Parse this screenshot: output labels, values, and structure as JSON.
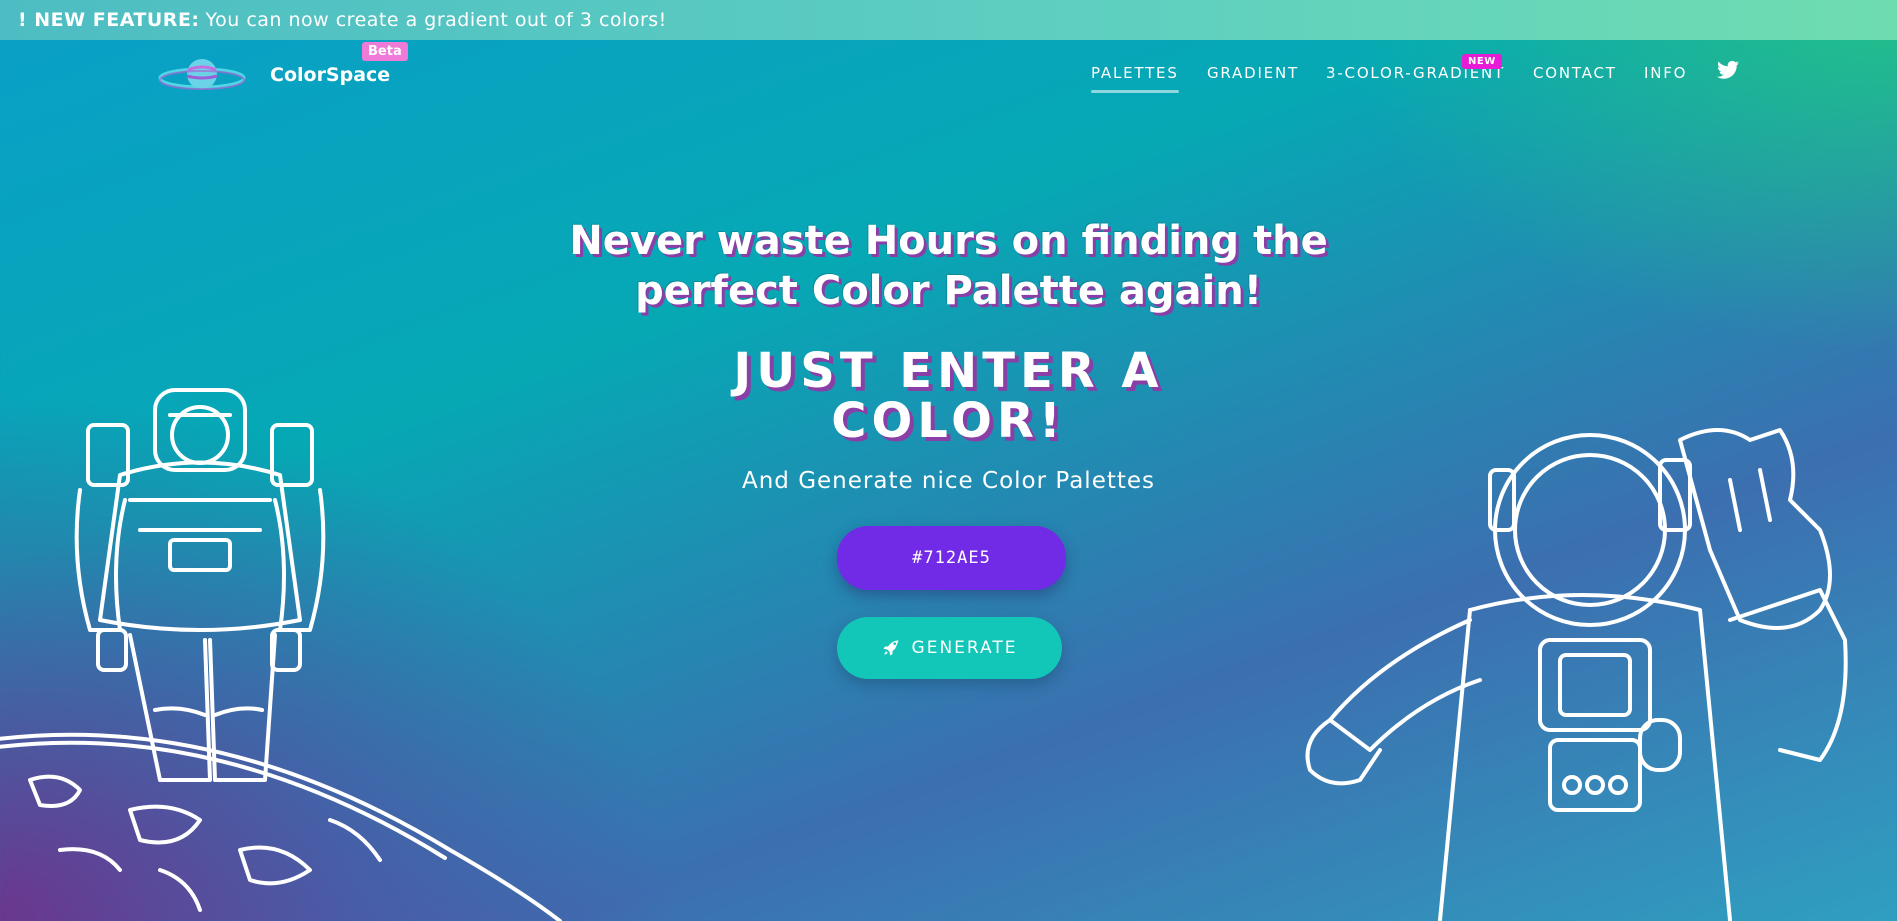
{
  "banner": {
    "label": "! NEW FEATURE:",
    "text": "You can now create a gradient out of 3 colors!"
  },
  "brand": {
    "name": "ColorSpace",
    "badge": "Beta",
    "logo_icon": "planet-icon"
  },
  "nav": {
    "items": [
      {
        "label": "PALETTES",
        "active": true
      },
      {
        "label": "GRADIENT",
        "active": false
      },
      {
        "label": "3-COLOR-GRADIENT",
        "active": false,
        "badge": "NEW"
      },
      {
        "label": "CONTACT",
        "active": false
      },
      {
        "label": "INFO",
        "active": false
      }
    ],
    "social_icon": "twitter-icon"
  },
  "hero": {
    "headline_line1": "Never waste Hours on finding the",
    "headline_line2": "perfect Color Palette again!",
    "subhead_line1": "JUST ENTER A",
    "subhead_line2": "COLOR!",
    "tagline": "And Generate nice Color Palettes",
    "input_value": "#712AE5",
    "generate_label": "GENERATE",
    "generate_icon": "rocket-icon"
  },
  "colors": {
    "input_bg": "#712ae5",
    "generate_bg": "#12c6b8",
    "beta_badge": "#f07ad8",
    "new_badge": "#e81cd6"
  }
}
